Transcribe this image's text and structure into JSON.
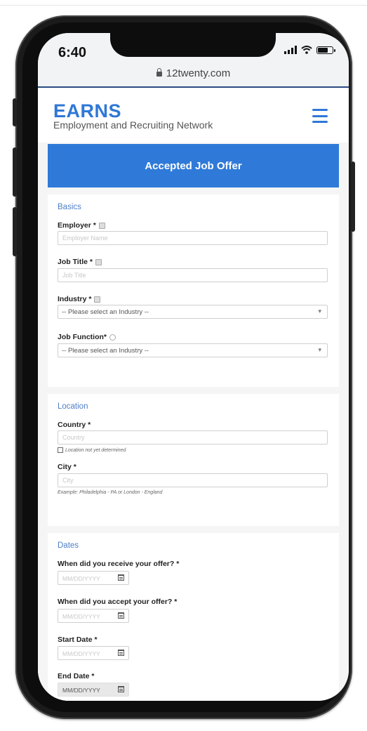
{
  "status": {
    "time": "6:40"
  },
  "browser": {
    "url": "12twenty.com"
  },
  "brand": {
    "logo": "EARNS",
    "tagline": "Employment and Recruiting Network"
  },
  "banner": {
    "title": "Accepted Job Offer"
  },
  "basics": {
    "title": "Basics",
    "employer": {
      "label": "Employer *",
      "placeholder": "Employer Name"
    },
    "job_title": {
      "label": "Job Title *",
      "placeholder": "Job Title"
    },
    "industry": {
      "label": "Industry *",
      "value": "-- Please select an Industry --"
    },
    "job_function": {
      "label": "Job Function*",
      "value": "-- Please select an Industry --"
    }
  },
  "location": {
    "title": "Location",
    "country": {
      "label": "Country *",
      "placeholder": "Country",
      "hint": "Location not yet determined"
    },
    "city": {
      "label": "City *",
      "placeholder": "City",
      "hint": "Example: Philadelphia - PA or London - England"
    }
  },
  "dates": {
    "title": "Dates",
    "received": {
      "label": "When did you receive your offer? *",
      "placeholder": "MM/DD/YYYY"
    },
    "accepted": {
      "label": "When did you accept your offer? *",
      "placeholder": "MM/DD/YYYY"
    },
    "start": {
      "label": "Start Date *",
      "placeholder": "MM/DD/YYYY"
    },
    "end": {
      "label": "End Date *",
      "value": "MM/DD/YYYY"
    }
  }
}
